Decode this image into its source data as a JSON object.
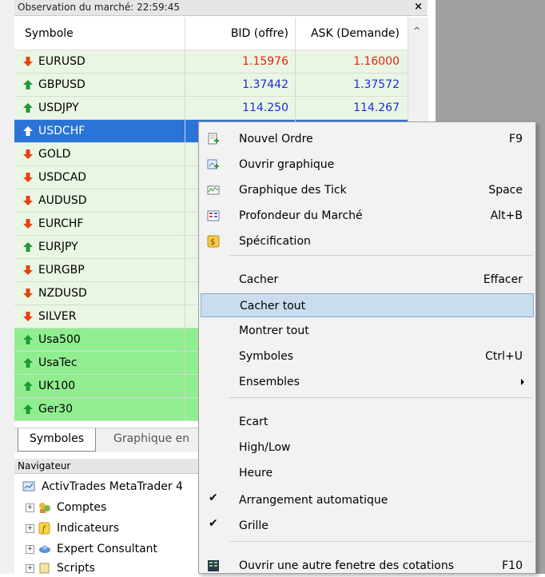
{
  "market_watch": {
    "title": "Observation du marché: 22:59:45",
    "close_glyph": "×",
    "columns": {
      "symbol": "Symbole",
      "bid": "BID (offre)",
      "ask": "ASK (Demande)"
    },
    "rows": [
      {
        "symbol": "EURUSD",
        "bid": "1.15976",
        "ask": "1.16000",
        "dir": "down",
        "color": "#e8220f",
        "style": "normal"
      },
      {
        "symbol": "GBPUSD",
        "bid": "1.37442",
        "ask": "1.37572",
        "dir": "up",
        "color": "#1a2fd6",
        "style": "normal"
      },
      {
        "symbol": "USDJPY",
        "bid": "114.250",
        "ask": "114.267",
        "dir": "up",
        "color": "#1a2fd6",
        "style": "normal"
      },
      {
        "symbol": "USDCHF",
        "bid": "",
        "ask": "",
        "dir": "up",
        "color": "#ffffff",
        "style": "sel"
      },
      {
        "symbol": "GOLD",
        "bid": "",
        "ask": "",
        "dir": "down",
        "color": "#000000",
        "style": "normal"
      },
      {
        "symbol": "USDCAD",
        "bid": "",
        "ask": "",
        "dir": "down",
        "color": "#000000",
        "style": "normal"
      },
      {
        "symbol": "AUDUSD",
        "bid": "",
        "ask": "",
        "dir": "down",
        "color": "#000000",
        "style": "normal"
      },
      {
        "symbol": "EURCHF",
        "bid": "",
        "ask": "",
        "dir": "down",
        "color": "#000000",
        "style": "normal"
      },
      {
        "symbol": "EURJPY",
        "bid": "",
        "ask": "",
        "dir": "up",
        "color": "#000000",
        "style": "normal"
      },
      {
        "symbol": "EURGBP",
        "bid": "",
        "ask": "",
        "dir": "down",
        "color": "#000000",
        "style": "normal"
      },
      {
        "symbol": "NZDUSD",
        "bid": "",
        "ask": "",
        "dir": "down",
        "color": "#000000",
        "style": "normal"
      },
      {
        "symbol": "SILVER",
        "bid": "",
        "ask": "",
        "dir": "down",
        "color": "#000000",
        "style": "normal"
      },
      {
        "symbol": "Usa500",
        "bid": "",
        "ask": "",
        "dir": "up",
        "color": "#000000",
        "style": "green"
      },
      {
        "symbol": "UsaTec",
        "bid": "",
        "ask": "",
        "dir": "up",
        "color": "#000000",
        "style": "green"
      },
      {
        "symbol": "UK100",
        "bid": "",
        "ask": "",
        "dir": "up",
        "color": "#000000",
        "style": "green"
      },
      {
        "symbol": "Ger30",
        "bid": "",
        "ask": "",
        "dir": "up",
        "color": "#000000",
        "style": "green"
      }
    ],
    "tabs": {
      "active": "Symboles",
      "inactive": "Graphique en"
    }
  },
  "navigator": {
    "title": "Navigateur",
    "root": "ActivTrades MetaTrader 4",
    "items": [
      "Comptes",
      "Indicateurs",
      "Expert Consultant",
      "Scripts"
    ]
  },
  "context_menu": {
    "items": [
      {
        "label": "Nouvel Ordre",
        "shortcut": "F9",
        "icon": "new-order-icon"
      },
      {
        "label": "Ouvrir graphique",
        "shortcut": "",
        "icon": "open-chart-icon"
      },
      {
        "label": "Graphique des Tick",
        "shortcut": "Space",
        "icon": "tick-chart-icon"
      },
      {
        "label": "Profondeur du Marché",
        "shortcut": "Alt+B",
        "icon": "market-depth-icon"
      },
      {
        "label": "Spécification",
        "shortcut": "",
        "icon": "specification-icon"
      },
      {
        "label": "Cacher",
        "shortcut": "Effacer"
      },
      {
        "label": "Cacher tout",
        "shortcut": ""
      },
      {
        "label": "Montrer tout",
        "shortcut": ""
      },
      {
        "label": "Symboles",
        "shortcut": "Ctrl+U"
      },
      {
        "label": "Ensembles",
        "shortcut": "",
        "submenu": true
      },
      {
        "label": "Ecart",
        "shortcut": ""
      },
      {
        "label": "High/Low",
        "shortcut": ""
      },
      {
        "label": "Heure",
        "shortcut": ""
      },
      {
        "label": "Arrangement automatique",
        "shortcut": "",
        "checked": true
      },
      {
        "label": "Grille",
        "shortcut": "",
        "checked": true
      },
      {
        "label": "Ouvrir une autre fenetre des cotations",
        "shortcut": "F10",
        "icon": "new-window-icon"
      }
    ],
    "check_glyph": "✔",
    "colors": {
      "highlight": "#c9ddef",
      "selected_row": "#2b73d6",
      "row_normal": "#eaf6e4",
      "row_green": "#90ee90",
      "down_arrow": "#e8420f",
      "up_arrow": "#1e9a3a"
    }
  }
}
